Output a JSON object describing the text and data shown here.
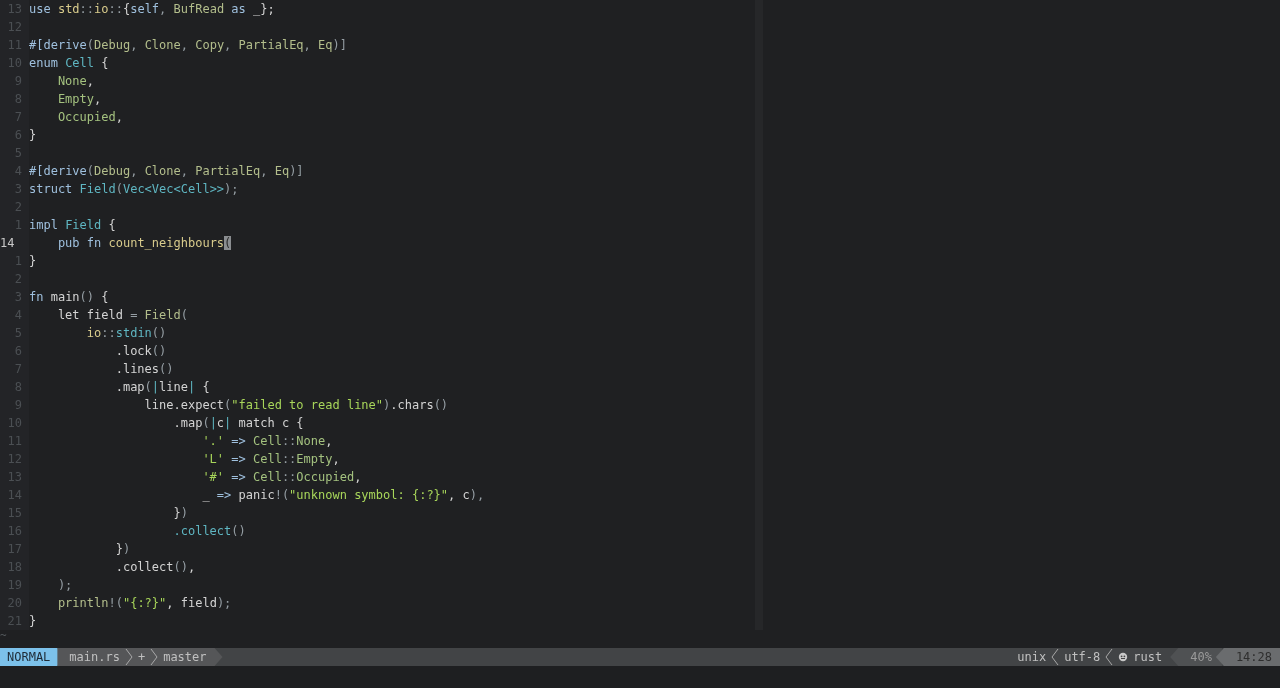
{
  "editor": {
    "lines": [
      {
        "number": "13",
        "current": false,
        "tokens": [
          {
            "kind": "kw",
            "text": "use "
          },
          {
            "kind": "mod",
            "text": "std"
          },
          {
            "kind": "punct",
            "text": "::"
          },
          {
            "kind": "mod",
            "text": "io"
          },
          {
            "kind": "punct",
            "text": "::"
          },
          {
            "kind": "plain",
            "text": "{"
          },
          {
            "kind": "kw",
            "text": "self"
          },
          {
            "kind": "punct",
            "text": ", "
          },
          {
            "kind": "trait",
            "text": "BufRead"
          },
          {
            "kind": "kw",
            "text": " as "
          },
          {
            "kind": "plain",
            "text": "_};"
          }
        ]
      },
      {
        "number": "12",
        "current": false
      },
      {
        "number": "11",
        "current": false,
        "tokens": [
          {
            "kind": "kw",
            "text": "#["
          },
          {
            "kind": "kw",
            "text": "derive"
          },
          {
            "kind": "punct",
            "text": "("
          },
          {
            "kind": "trait",
            "text": "Debug"
          },
          {
            "kind": "punct",
            "text": ", "
          },
          {
            "kind": "trait",
            "text": "Clone"
          },
          {
            "kind": "punct",
            "text": ", "
          },
          {
            "kind": "trait",
            "text": "Copy"
          },
          {
            "kind": "punct",
            "text": ", "
          },
          {
            "kind": "trait",
            "text": "PartialEq"
          },
          {
            "kind": "punct",
            "text": ", "
          },
          {
            "kind": "trait",
            "text": "Eq"
          },
          {
            "kind": "punct",
            "text": ")]"
          }
        ]
      },
      {
        "number": "10",
        "current": false,
        "tokens": [
          {
            "kind": "kw",
            "text": "enum "
          },
          {
            "kind": "type",
            "text": "Cell"
          },
          {
            "kind": "plain",
            "text": " {"
          }
        ]
      },
      {
        "number": "9",
        "current": false,
        "tokens": [
          {
            "kind": "variant",
            "text": "    None"
          },
          {
            "kind": "plain",
            "text": ","
          }
        ]
      },
      {
        "number": "8",
        "current": false,
        "tokens": [
          {
            "kind": "variant",
            "text": "    Empty"
          },
          {
            "kind": "plain",
            "text": ","
          }
        ]
      },
      {
        "number": "7",
        "current": false,
        "tokens": [
          {
            "kind": "variant",
            "text": "    Occupied"
          },
          {
            "kind": "plain",
            "text": ","
          }
        ]
      },
      {
        "number": "6",
        "current": false,
        "tokens": [
          {
            "kind": "plain",
            "text": "}"
          }
        ]
      },
      {
        "number": "5",
        "current": false
      },
      {
        "number": "4",
        "current": false,
        "tokens": [
          {
            "kind": "kw",
            "text": "#["
          },
          {
            "kind": "kw",
            "text": "derive"
          },
          {
            "kind": "punct",
            "text": "("
          },
          {
            "kind": "trait",
            "text": "Debug"
          },
          {
            "kind": "punct",
            "text": ", "
          },
          {
            "kind": "trait",
            "text": "Clone"
          },
          {
            "kind": "punct",
            "text": ", "
          },
          {
            "kind": "trait",
            "text": "PartialEq"
          },
          {
            "kind": "punct",
            "text": ", "
          },
          {
            "kind": "trait",
            "text": "Eq"
          },
          {
            "kind": "punct",
            "text": ")]"
          }
        ]
      },
      {
        "number": "3",
        "current": false,
        "tokens": [
          {
            "kind": "kw",
            "text": "struct "
          },
          {
            "kind": "type",
            "text": "Field"
          },
          {
            "kind": "punct",
            "text": "("
          },
          {
            "kind": "type",
            "text": "Vec<Vec<Cell>>"
          },
          {
            "kind": "punct",
            "text": ");"
          }
        ]
      },
      {
        "number": "2",
        "current": false
      },
      {
        "number": "1",
        "current": false,
        "tokens": [
          {
            "kind": "kw",
            "text": "impl "
          },
          {
            "kind": "type",
            "text": "Field"
          },
          {
            "kind": "plain",
            "text": " {"
          }
        ]
      },
      {
        "number": "14",
        "current": true,
        "tokens": [
          {
            "kind": "kw",
            "text": "    pub fn "
          },
          {
            "kind": "mod",
            "text": "count_neighbours"
          },
          {
            "kind": "cursor",
            "text": "("
          }
        ]
      },
      {
        "number": "1",
        "current": false,
        "tokens": [
          {
            "kind": "plain",
            "text": "}"
          }
        ]
      },
      {
        "number": "2",
        "current": false
      },
      {
        "number": "3",
        "current": false,
        "tokens": [
          {
            "kind": "kw",
            "text": "fn"
          },
          {
            "kind": "plain",
            "text": " main"
          },
          {
            "kind": "punct",
            "text": "()"
          },
          {
            "kind": "plain",
            "text": " {"
          }
        ]
      },
      {
        "number": "4",
        "current": false,
        "tokens": [
          {
            "kind": "plain",
            "text": "    let field "
          },
          {
            "kind": "punct",
            "text": "= "
          },
          {
            "kind": "trait",
            "text": "Field"
          },
          {
            "kind": "punct",
            "text": "("
          }
        ]
      },
      {
        "number": "5",
        "current": false,
        "tokens": [
          {
            "kind": "mod",
            "text": "        io"
          },
          {
            "kind": "punct",
            "text": "::"
          },
          {
            "kind": "type",
            "text": "stdin"
          },
          {
            "kind": "punct",
            "text": "()"
          }
        ]
      },
      {
        "number": "6",
        "current": false,
        "tokens": [
          {
            "kind": "plain",
            "text": "            .lock"
          },
          {
            "kind": "punct",
            "text": "()"
          }
        ]
      },
      {
        "number": "7",
        "current": false,
        "tokens": [
          {
            "kind": "plain",
            "text": "            .lines"
          },
          {
            "kind": "punct",
            "text": "()"
          }
        ]
      },
      {
        "number": "8",
        "current": false,
        "tokens": [
          {
            "kind": "plain",
            "text": "            .map"
          },
          {
            "kind": "punct",
            "text": "("
          },
          {
            "kind": "type",
            "text": "|"
          },
          {
            "kind": "plain",
            "text": "line"
          },
          {
            "kind": "type",
            "text": "|"
          },
          {
            "kind": "plain",
            "text": " {"
          }
        ]
      },
      {
        "number": "9",
        "current": false,
        "tokens": [
          {
            "kind": "plain",
            "text": "                line.expect"
          },
          {
            "kind": "punct",
            "text": "("
          },
          {
            "kind": "string",
            "text": "\"failed to read line\""
          },
          {
            "kind": "punct",
            "text": ")"
          },
          {
            "kind": "plain",
            "text": ".chars"
          },
          {
            "kind": "punct",
            "text": "()"
          }
        ]
      },
      {
        "number": "10",
        "current": false,
        "tokens": [
          {
            "kind": "plain",
            "text": "                    .map"
          },
          {
            "kind": "punct",
            "text": "("
          },
          {
            "kind": "type",
            "text": "|"
          },
          {
            "kind": "plain",
            "text": "c"
          },
          {
            "kind": "type",
            "text": "|"
          },
          {
            "kind": "plain",
            "text": " match c {"
          }
        ]
      },
      {
        "number": "11",
        "current": false,
        "tokens": [
          {
            "kind": "string",
            "text": "                        '.'"
          },
          {
            "kind": "kw",
            "text": " => "
          },
          {
            "kind": "variant",
            "text": "Cell"
          },
          {
            "kind": "punct",
            "text": "::"
          },
          {
            "kind": "variant",
            "text": "None"
          },
          {
            "kind": "plain",
            "text": ","
          }
        ]
      },
      {
        "number": "12",
        "current": false,
        "tokens": [
          {
            "kind": "string",
            "text": "                        'L'"
          },
          {
            "kind": "kw",
            "text": " => "
          },
          {
            "kind": "variant",
            "text": "Cell"
          },
          {
            "kind": "punct",
            "text": "::"
          },
          {
            "kind": "variant",
            "text": "Empty"
          },
          {
            "kind": "plain",
            "text": ","
          }
        ]
      },
      {
        "number": "13",
        "current": false,
        "tokens": [
          {
            "kind": "string",
            "text": "                        '#'"
          },
          {
            "kind": "kw",
            "text": " => "
          },
          {
            "kind": "variant",
            "text": "Cell"
          },
          {
            "kind": "punct",
            "text": "::"
          },
          {
            "kind": "variant",
            "text": "Occupied"
          },
          {
            "kind": "plain",
            "text": ","
          }
        ]
      },
      {
        "number": "14",
        "current": false,
        "tokens": [
          {
            "kind": "plain",
            "text": "                        _"
          },
          {
            "kind": "kw",
            "text": " => "
          },
          {
            "kind": "plain",
            "text": "panic"
          },
          {
            "kind": "punct",
            "text": "!("
          },
          {
            "kind": "string",
            "text": "\"unknown symbol: {:?}\""
          },
          {
            "kind": "plain",
            "text": ", c"
          },
          {
            "kind": "punct",
            "text": "),"
          }
        ]
      },
      {
        "number": "15",
        "current": false,
        "tokens": [
          {
            "kind": "plain",
            "text": "                    }"
          },
          {
            "kind": "punct",
            "text": ")"
          }
        ]
      },
      {
        "number": "16",
        "current": false,
        "tokens": [
          {
            "kind": "type",
            "text": "                    .collect"
          },
          {
            "kind": "punct",
            "text": "()"
          }
        ]
      },
      {
        "number": "17",
        "current": false,
        "tokens": [
          {
            "kind": "plain",
            "text": "            }"
          },
          {
            "kind": "punct",
            "text": ")"
          }
        ]
      },
      {
        "number": "18",
        "current": false,
        "tokens": [
          {
            "kind": "plain",
            "text": "            .collect"
          },
          {
            "kind": "punct",
            "text": "()"
          },
          {
            "kind": "plain",
            "text": ","
          }
        ]
      },
      {
        "number": "19",
        "current": false,
        "tokens": [
          {
            "kind": "punct",
            "text": "    );"
          }
        ]
      },
      {
        "number": "20",
        "current": false,
        "tokens": [
          {
            "kind": "trait",
            "text": "    println"
          },
          {
            "kind": "punct",
            "text": "!("
          },
          {
            "kind": "string",
            "text": "\"{:?}\""
          },
          {
            "kind": "plain",
            "text": ", field"
          },
          {
            "kind": "punct",
            "text": ");"
          }
        ]
      },
      {
        "number": "21",
        "current": false,
        "tokens": [
          {
            "kind": "plain",
            "text": "}"
          }
        ]
      }
    ],
    "filler_lines": [
      "~"
    ]
  },
  "status_bar": {
    "mode": "NORMAL",
    "left": [
      {
        "text": "main.rs"
      },
      {
        "text": "+"
      },
      {
        "text": "master"
      }
    ],
    "right": [
      {
        "kind": "text",
        "text": "unix"
      },
      {
        "kind": "text",
        "text": "utf-8"
      },
      {
        "kind": "filetype",
        "text": "rust"
      }
    ],
    "percent": "40%",
    "time": "14:28"
  }
}
